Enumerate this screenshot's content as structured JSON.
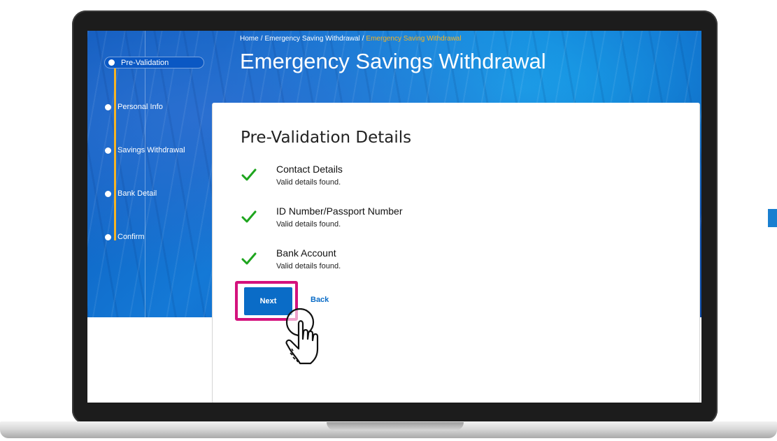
{
  "breadcrumb": {
    "items": [
      "Home",
      "Emergency Saving Withdrawal"
    ],
    "current": "Emergency Saving Withdrawal"
  },
  "page_title": "Emergency Savings Withdrawal",
  "stepper": {
    "active_index": 0,
    "steps": [
      {
        "label": "Pre-Validation"
      },
      {
        "label": "Personal Info"
      },
      {
        "label": "Savings Withdrawal"
      },
      {
        "label": "Bank Detail"
      },
      {
        "label": "Confirm"
      }
    ]
  },
  "card": {
    "title": "Pre-Validation Details",
    "checks": [
      {
        "title": "Contact Details",
        "status": "Valid details found."
      },
      {
        "title": "ID Number/Passport Number",
        "status": "Valid details found."
      },
      {
        "title": "Bank Account",
        "status": "Valid details found."
      }
    ],
    "next_label": "Next",
    "back_label": "Back"
  },
  "colors": {
    "accent_blue": "#0a6cc7",
    "stepper_gold": "#f5b324",
    "check_green": "#1ea51e",
    "highlight_magenta": "#d4127d"
  },
  "icons": {
    "check": "check-icon",
    "cursor": "hand-pointer-icon",
    "step_marker": "dot-icon"
  }
}
